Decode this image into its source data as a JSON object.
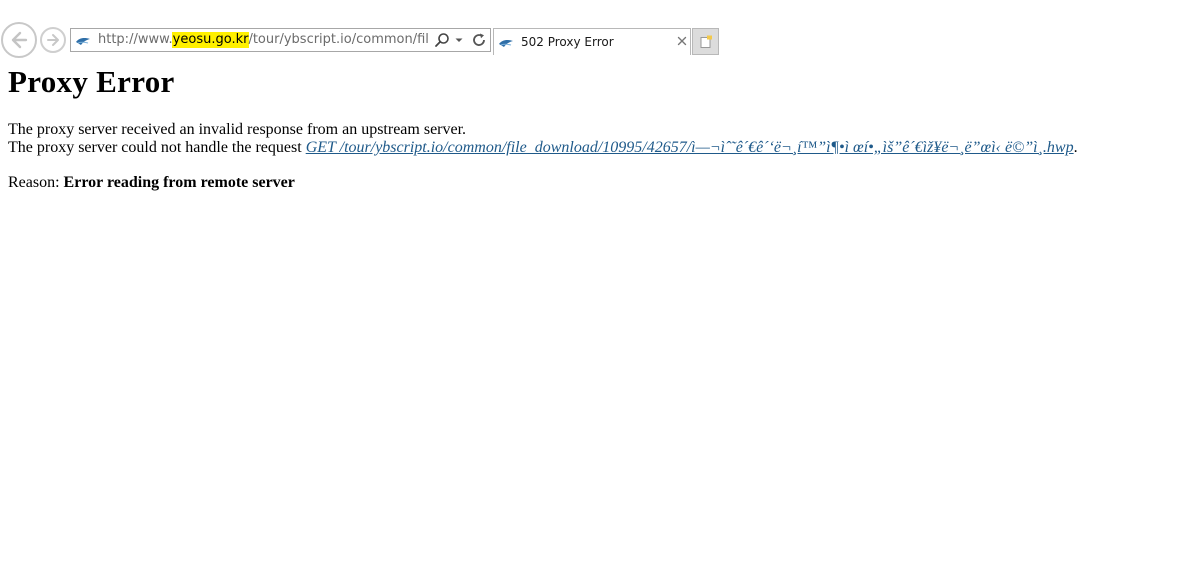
{
  "browser": {
    "url": {
      "prefix": "http://www.",
      "domain": "yeosu.go.kr",
      "path": "/tour/ybscript.io/common/file_downlo"
    },
    "tab": {
      "title": "502 Proxy Error"
    },
    "icons": {
      "back": "back-arrow-icon",
      "forward": "forward-arrow-icon",
      "favicon": "site-favicon-icon",
      "search": "search-icon",
      "dropdown": "chevron-down-icon",
      "refresh": "refresh-icon",
      "close": "close-icon",
      "new_tab": "new-tab-icon"
    },
    "colors": {
      "domain_highlight": "#fff000",
      "link": "#1f5a8a"
    }
  },
  "page": {
    "heading": "Proxy Error",
    "line1": "The proxy server received an invalid response from an upstream server.",
    "line2_prefix": "The proxy server could not handle the request ",
    "request_link": "GET /tour/ybscript.io/common/file_download/10995/42657/ì—¬ìˆ˜ê´€ê´‘ë¬¸í™”ì¶•ì œí•„ìš”ê´€ìž¥ë¬¸ë”œì‹ ë©”ì¸.hwp",
    "line2_suffix": ".",
    "reason_label": "Reason: ",
    "reason_text": "Error reading from remote server"
  }
}
